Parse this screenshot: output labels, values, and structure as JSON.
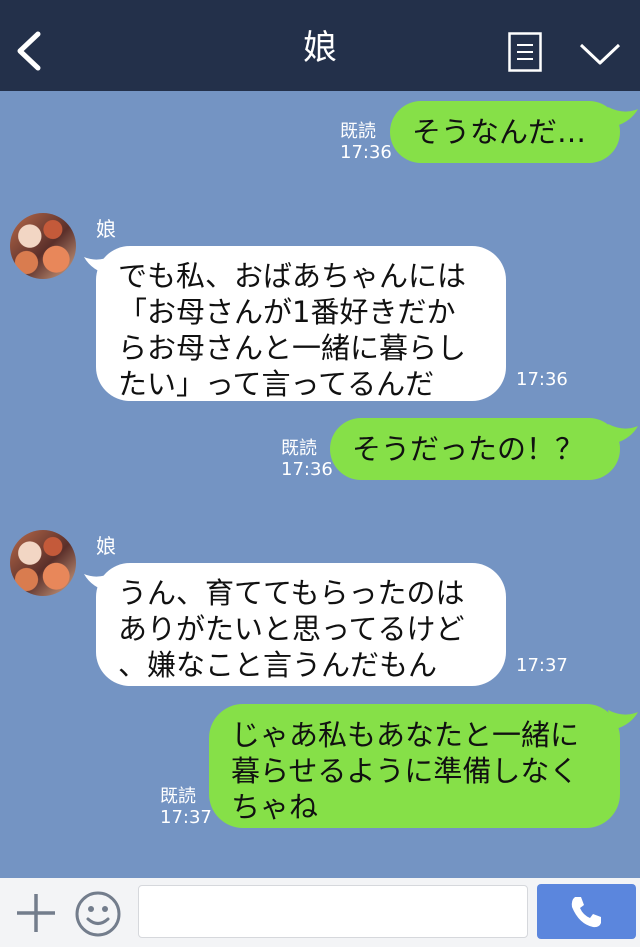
{
  "header": {
    "title": "娘"
  },
  "messages": [
    {
      "direction": "out",
      "text": "そうなんだ…",
      "read_label": "既読",
      "time": "17:36"
    },
    {
      "direction": "in",
      "sender": "娘",
      "text": "でも私、おばあちゃんには\n「お母さんが1番好きだか\nらお母さんと一緒に暮らし\nたい」って言ってるんだ",
      "time": "17:36"
    },
    {
      "direction": "out",
      "text": "そうだったの！？",
      "read_label": "既読",
      "time": "17:36"
    },
    {
      "direction": "in",
      "sender": "娘",
      "text": "うん、育ててもらったのは\nありがたいと思ってるけど\n、嫌なこと言うんだもん",
      "time": "17:37"
    },
    {
      "direction": "out",
      "text": "じゃあ私もあなたと一緒に\n暮らせるように準備しなく\nちゃね",
      "read_label": "既読",
      "time": "17:37"
    }
  ],
  "footer": {
    "input_value": "",
    "icons": [
      "plus-icon",
      "emoji-icon",
      "phone-icon"
    ]
  },
  "colors": {
    "header_bg": "#23304a",
    "chat_bg": "#7494c3",
    "outgoing_bubble": "#86e048",
    "incoming_bubble": "#ffffff",
    "call_button": "#5b86dd"
  }
}
